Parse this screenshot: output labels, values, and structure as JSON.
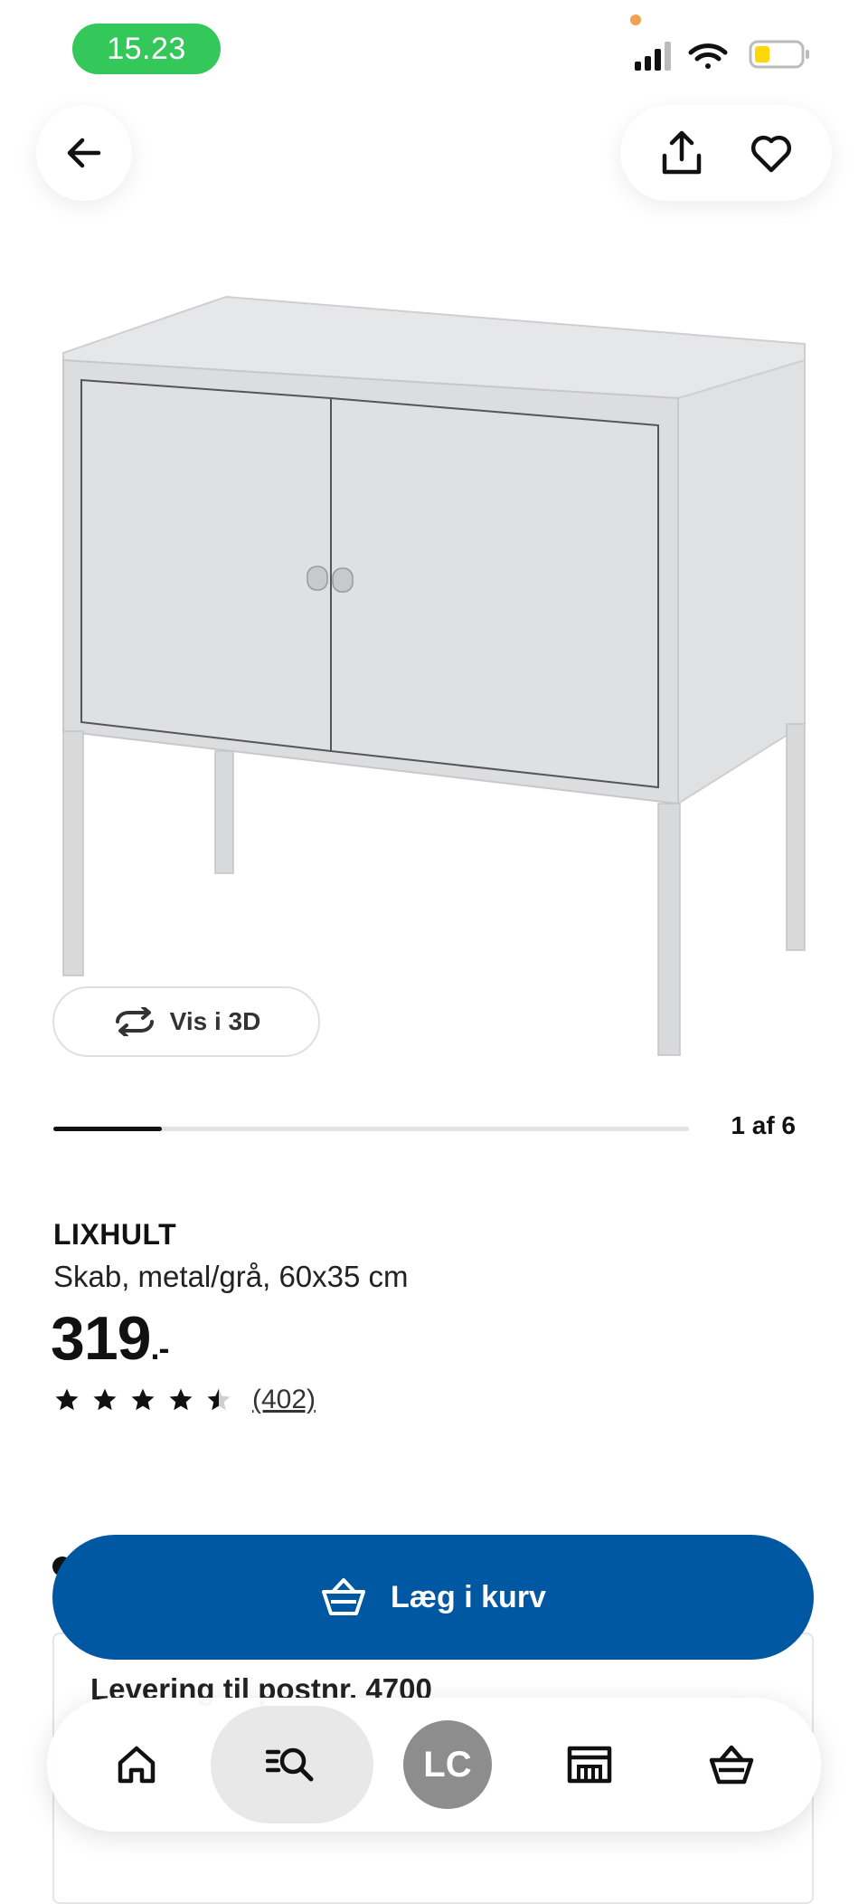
{
  "status_bar": {
    "time": "15.23"
  },
  "header": {
    "back_icon": "arrow-left-icon",
    "share_icon": "share-icon",
    "favorite_icon": "heart-icon"
  },
  "gallery": {
    "view_3d_label": "Vis i 3D",
    "counter": "1 af 6",
    "progress": 0.17
  },
  "product": {
    "name": "LIXHULT",
    "description": "Skab, metal/grå, 60x35 cm",
    "price": "319",
    "price_suffix": ".-",
    "rating": 4.5,
    "review_count": "(402)"
  },
  "cta": {
    "add_to_cart": "Læg i kurv"
  },
  "delivery": {
    "title": "Levering til postnr. 4700"
  },
  "bottom_nav": {
    "items": [
      "home-icon",
      "search-icon",
      "profile-avatar",
      "store-icon",
      "basket-icon"
    ],
    "avatar_initials": "LC"
  },
  "colors": {
    "primary": "#0058a3",
    "time_pill": "#34c759"
  }
}
